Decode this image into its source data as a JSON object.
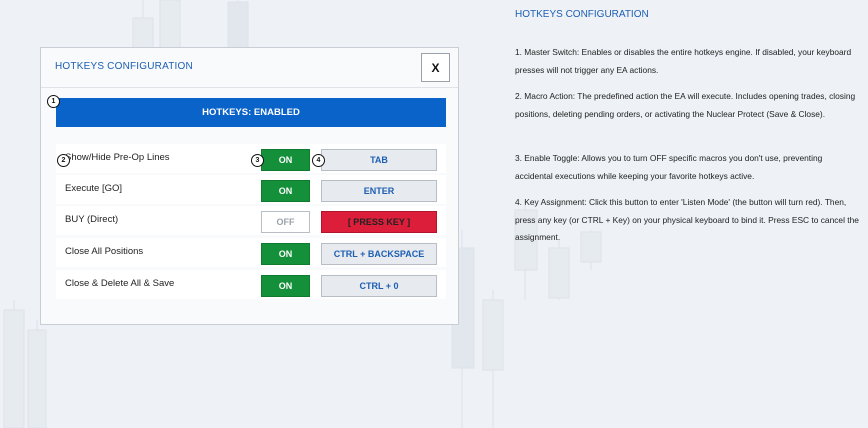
{
  "dialog": {
    "title": "HOTKEYS CONFIGURATION",
    "close_label": "X",
    "master_switch_label": "HOTKEYS: ENABLED",
    "rows": [
      {
        "label": "Show/Hide Pre-Op Lines",
        "toggle": "ON",
        "key": "TAB",
        "key_state": "normal"
      },
      {
        "label": "Execute [GO]",
        "toggle": "ON",
        "key": "ENTER",
        "key_state": "normal"
      },
      {
        "label": "BUY (Direct)",
        "toggle": "OFF",
        "key": "[ PRESS KEY ]",
        "key_state": "listening"
      },
      {
        "label": "Close All Positions",
        "toggle": "ON",
        "key": "CTRL + BACKSPACE",
        "key_state": "normal"
      },
      {
        "label": "Close & Delete All & Save",
        "toggle": "ON",
        "key": "CTRL + 0",
        "key_state": "normal"
      }
    ]
  },
  "markers": [
    "1",
    "2",
    "3",
    "4"
  ],
  "help": {
    "title": "HOTKEYS CONFIGURATION",
    "items": [
      "1. Master Switch: Enables or disables the entire hotkeys engine. If disabled, your keyboard presses will not trigger any EA actions.",
      "2. Macro Action: The predefined action the EA will execute. Includes opening trades, closing positions, deleting pending orders, or activating the Nuclear Protect (Save & Close).",
      "3. Enable Toggle: Allows you to turn OFF specific macros you don't use, preventing accidental executions while keeping your favorite hotkeys active.",
      "4. Key Assignment: Click this button to enter 'Listen Mode' (the button will turn red). Then, press any key (or CTRL + Key) on your physical keyboard to bind it. Press ESC to cancel the assignment."
    ]
  },
  "colors": {
    "accent_blue": "#0a63c9",
    "toggle_on": "#15903a",
    "listening_red": "#dc1e3a",
    "title_blue": "#1d5fb3"
  }
}
